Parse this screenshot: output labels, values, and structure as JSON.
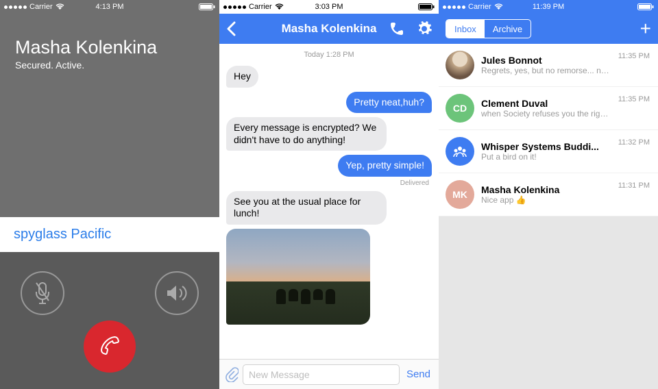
{
  "common": {
    "carrier": "Carrier"
  },
  "screen1": {
    "time": "4:13 PM",
    "caller_name": "Masha Kolenkina",
    "caller_status": "Secured. Active.",
    "sas_phrase": "spyglass Pacific"
  },
  "screen2": {
    "time": "3:03 PM",
    "title": "Masha Kolenkina",
    "day_label": "Today 1:28 PM",
    "msg1": "Hey",
    "msg2": "Pretty neat,huh?",
    "msg3": "Every message is encrypted? We didn't have to do anything!",
    "msg4": "Yep, pretty simple!",
    "delivered": "Delivered",
    "msg5": "See you at the usual place for lunch!",
    "compose_placeholder": "New Message",
    "send_label": "Send"
  },
  "screen3": {
    "time": "11:39 PM",
    "seg_inbox": "Inbox",
    "seg_archive": "Archive",
    "rows": [
      {
        "initials": "",
        "name": "Jules Bonnot",
        "preview": "Regrets, yes, but no remorse... not even",
        "time": "11:35 PM"
      },
      {
        "initials": "CD",
        "name": "Clement Duval",
        "preview": "when Society refuses you the right to exi...",
        "time": "11:35 PM"
      },
      {
        "initials": "",
        "name": "Whisper Systems Buddi...",
        "preview": "Put a bird on it!",
        "time": "11:32 PM"
      },
      {
        "initials": "MK",
        "name": "Masha Kolenkina",
        "preview": "Nice app 👍",
        "time": "11:31 PM"
      }
    ]
  }
}
